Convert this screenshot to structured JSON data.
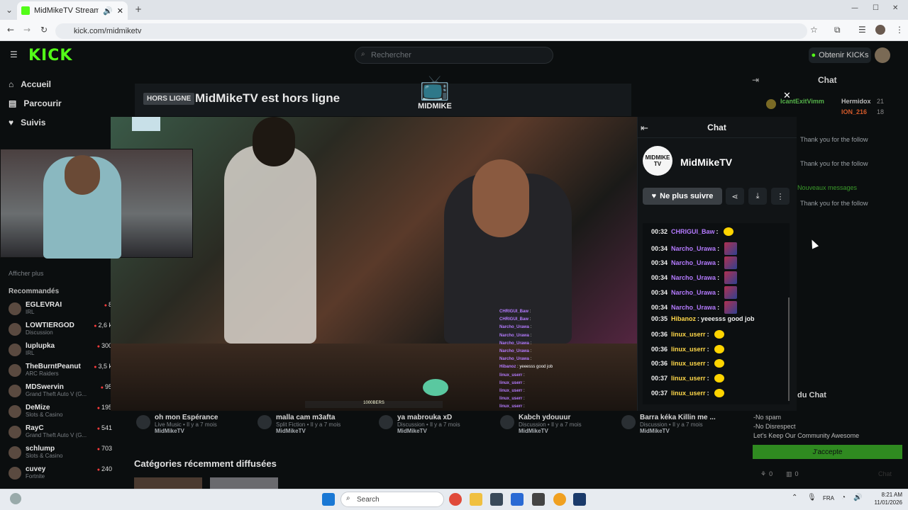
{
  "browser": {
    "tab_title": "MidMikeTV Stream - Watch",
    "url": "kick.com/midmiketv",
    "new_tab": "+",
    "window_controls": [
      "—",
      "☐",
      "✕"
    ]
  },
  "kick": {
    "logo": "KICK",
    "search_placeholder": "Rechercher",
    "get_kicks": "Obtenir KICKs",
    "nav": [
      {
        "label": "Accueil",
        "icon": "home-icon"
      },
      {
        "label": "Parcourir",
        "icon": "browse-icon"
      },
      {
        "label": "Suivis",
        "icon": "heart-icon"
      }
    ],
    "show_more": "Afficher plus",
    "recommended_title": "Recommandés",
    "recommended": [
      {
        "name": "EGLEVRAI",
        "category": "IRL",
        "count": "8"
      },
      {
        "name": "LOWTIERGOD",
        "category": "Discussion",
        "count": "2,6 k"
      },
      {
        "name": "luplupka",
        "category": "IRL",
        "count": "300"
      },
      {
        "name": "TheBurntPeanut",
        "category": "ARC Raiders",
        "count": "3,5 k"
      },
      {
        "name": "MDSwervin",
        "category": "Grand Theft Auto V (G...",
        "count": "95"
      },
      {
        "name": "DeMize",
        "category": "Slots & Casino",
        "count": "195"
      },
      {
        "name": "RayC",
        "category": "Grand Theft Auto V (G...",
        "count": "541"
      },
      {
        "name": "schlump",
        "category": "Slots & Casino",
        "count": "703"
      },
      {
        "name": "cuvey",
        "category": "Fortnite",
        "count": "240"
      }
    ],
    "offline_badge": "HORS LIGNE",
    "offline_title": "MidMikeTV est hors ligne",
    "tv_logo_text": "MIDMIKE",
    "right_chat_title": "Chat",
    "right_chat_users": [
      {
        "name": "IcantExitVimm"
      },
      {
        "name": "Hermidox",
        "count": "21"
      },
      {
        "name": "ION_216",
        "count": "18"
      }
    ],
    "right_chat_msgs": [
      "Thank you for the follow",
      "Thank you for the follow",
      "Thank you for the follow"
    ],
    "new_messages": "Nouveaux messages",
    "rules_title": "du Chat",
    "rules": [
      "-No spam",
      "-No Disrespect",
      "Let's Keep Our Community Awesome"
    ],
    "accept_label": "J'accepte",
    "bottom_counts": [
      "0",
      "0"
    ],
    "bottom_chat": "Chat"
  },
  "popout_chat": {
    "title": "Chat",
    "channel_name": "MidMikeTV",
    "avatar_text": "MIDMIKE TV",
    "unfollow_label": "Ne plus suivre",
    "messages": [
      {
        "time": "00:32",
        "user": "CHRIGUI_Baw",
        "text": "",
        "emote": "yellow"
      },
      {
        "time": "00:34",
        "user": "Narcho_Urawa",
        "text": "",
        "emote": "pic"
      },
      {
        "time": "00:34",
        "user": "Narcho_Urawa",
        "text": "",
        "emote": "pic"
      },
      {
        "time": "00:34",
        "user": "Narcho_Urawa",
        "text": "",
        "emote": "pic"
      },
      {
        "time": "00:34",
        "user": "Narcho_Urawa",
        "text": "",
        "emote": "pic"
      },
      {
        "time": "00:34",
        "user": "Narcho_Urawa",
        "text": "",
        "emote": "pic"
      },
      {
        "time": "00:35",
        "user": "Hibanoz",
        "text": "yeeesss good job",
        "emote": ""
      },
      {
        "time": "00:36",
        "user": "linux_userr",
        "text": "",
        "emote": "yellow"
      },
      {
        "time": "00:36",
        "user": "linux_userr",
        "text": "",
        "emote": "yellow"
      },
      {
        "time": "00:36",
        "user": "linux_userr",
        "text": "",
        "emote": "yellow"
      },
      {
        "time": "00:37",
        "user": "linux_userr",
        "text": "",
        "emote": "yellow"
      },
      {
        "time": "00:37",
        "user": "linux_userr",
        "text": "",
        "emote": "yellow"
      }
    ]
  },
  "video_overlay": {
    "lines": [
      {
        "user": "CHRIGUI_Baw",
        "text": ""
      },
      {
        "user": "CHRIGUI_Baw",
        "text": ""
      },
      {
        "user": "Narcho_Urawa",
        "text": ""
      },
      {
        "user": "Narcho_Urawa",
        "text": ""
      },
      {
        "user": "Narcho_Urawa",
        "text": ""
      },
      {
        "user": "Narcho_Urawa",
        "text": ""
      },
      {
        "user": "Narcho_Urawa",
        "text": ""
      },
      {
        "user": "Hibanoz",
        "text": "yeeesss good job"
      },
      {
        "user": "linux_userr",
        "text": ""
      },
      {
        "user": "linux_userr",
        "text": ""
      },
      {
        "user": "linux_userr",
        "text": ""
      },
      {
        "user": "linux_userr",
        "text": ""
      },
      {
        "user": "linux_userr",
        "text": ""
      }
    ],
    "scrub_label": "1000BERS"
  },
  "videos": [
    {
      "title": "oh mon Espérance",
      "category": "Live Music",
      "age": "Il y a 7 mois",
      "channel": "MidMikeTV"
    },
    {
      "title": "malla cam m3afta",
      "category": "Split Fiction",
      "age": "Il y a 7 mois",
      "channel": "MidMikeTV"
    },
    {
      "title": "ya mabrouka xD",
      "category": "Discussion",
      "age": "Il y a 7 mois",
      "channel": "MidMikeTV"
    },
    {
      "title": "Kabch ydouuur",
      "category": "Discussion",
      "age": "Il y a 7 mois",
      "channel": "MidMikeTV"
    },
    {
      "title": "Barra kéka Killin me ...",
      "category": "Discussion",
      "age": "Il y a 7 mois",
      "channel": "MidMikeTV"
    }
  ],
  "categories_title": "Catégories récemment diffusées",
  "taskbar": {
    "search": "Search",
    "lang": "FRA",
    "time": "8:21 AM",
    "date": "11/01/2026"
  }
}
